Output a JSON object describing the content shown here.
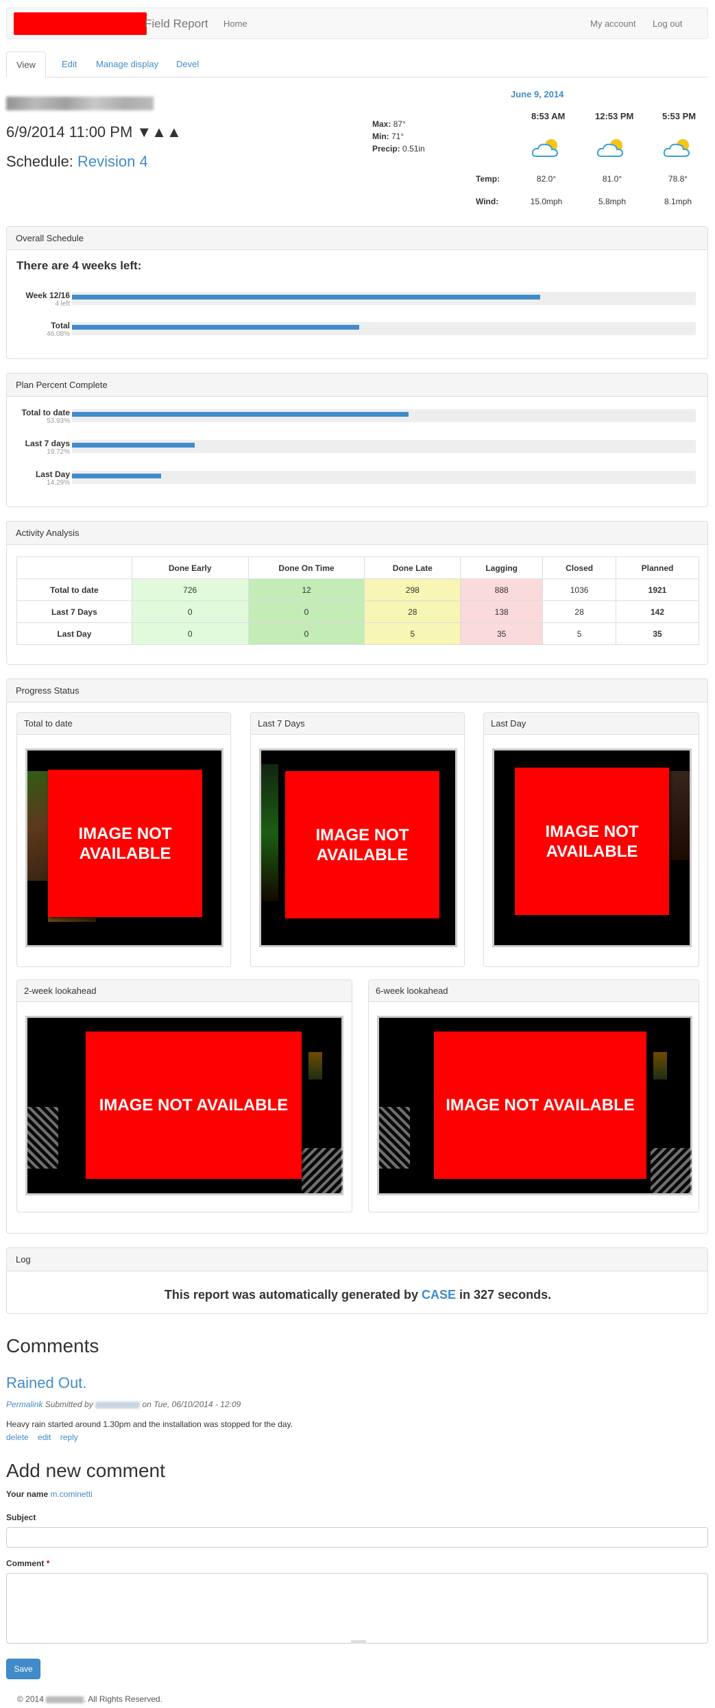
{
  "navbar": {
    "brand": "Field Report",
    "home": "Home",
    "my_account": "My account",
    "logout": "Log out"
  },
  "tabs": [
    "View",
    "Edit",
    "Manage display",
    "Devel"
  ],
  "header": {
    "datetime": "6/9/2014 11:00 PM ▼▲▲",
    "schedule_label": "Schedule:",
    "schedule_link": "Revision 4"
  },
  "weather_summary": {
    "max_label": "Max:",
    "max": "87°",
    "min_label": "Min:",
    "min": "71°",
    "precip_label": "Precip:",
    "precip": "0.51in"
  },
  "weather": {
    "date": "June 9, 2014",
    "temp_label": "Temp:",
    "wind_label": "Wind:",
    "times": [
      "8:53 AM",
      "12:53 PM",
      "5:53 PM"
    ],
    "temps": [
      "82.0°",
      "81.0°",
      "78.8°"
    ],
    "winds": [
      "15.0mph",
      "5.8mph",
      "8.1mph"
    ],
    "icon": "partly-cloudy-icon"
  },
  "overall": {
    "title": "Overall Schedule",
    "heading": "There are 4 weeks left:",
    "rows": [
      {
        "label": "Week 12/16",
        "sub": "4 left",
        "fraction": 0.75
      },
      {
        "label": "Total",
        "sub": "46.08%",
        "fraction": 0.4608
      }
    ]
  },
  "plan": {
    "title": "Plan Percent Complete",
    "rows": [
      {
        "label": "Total to date",
        "sub": "53.93%",
        "fraction": 0.5393
      },
      {
        "label": "Last 7 days",
        "sub": "19.72%",
        "fraction": 0.1972
      },
      {
        "label": "Last Day",
        "sub": "14.29%",
        "fraction": 0.1429
      }
    ]
  },
  "activity": {
    "title": "Activity Analysis",
    "headers": [
      "Done Early",
      "Done On Time",
      "Done Late",
      "Lagging",
      "Closed",
      "Planned"
    ],
    "rows": [
      {
        "label": "Total to date",
        "values": [
          "726",
          "12",
          "298",
          "888",
          "1036",
          "1921"
        ]
      },
      {
        "label": "Last 7 Days",
        "values": [
          "0",
          "0",
          "28",
          "138",
          "28",
          "142"
        ]
      },
      {
        "label": "Last Day",
        "values": [
          "0",
          "0",
          "5",
          "35",
          "5",
          "35"
        ]
      }
    ]
  },
  "progress": {
    "title": "Progress Status",
    "na_text": "IMAGE NOT AVAILABLE",
    "panels": [
      "Total to date",
      "Last 7 Days",
      "Last Day",
      "2-week lookahead",
      "6-week lookahead"
    ]
  },
  "log": {
    "title": "Log",
    "pre": "This report was automatically generated by ",
    "link": "CASE",
    "post": " in 327 seconds."
  },
  "comments": {
    "heading": "Comments",
    "title": "Rained Out.",
    "permalink": "Permalink",
    "submitted": " Submitted by ",
    "on": " on Tue, 06/10/2014 - 12:09",
    "body": "Heavy rain started around 1.30pm and the installation was stopped for the day.",
    "actions": [
      "delete",
      "edit",
      "reply"
    ]
  },
  "add_comment": {
    "heading": "Add new comment",
    "your_name_label": "Your name",
    "your_name": "m.cominetti",
    "subject_label": "Subject",
    "comment_label": "Comment",
    "required_mark": "*",
    "save": "Save"
  },
  "footer": {
    "pre": "© 2014",
    "post": ". All Rights Reserved."
  }
}
